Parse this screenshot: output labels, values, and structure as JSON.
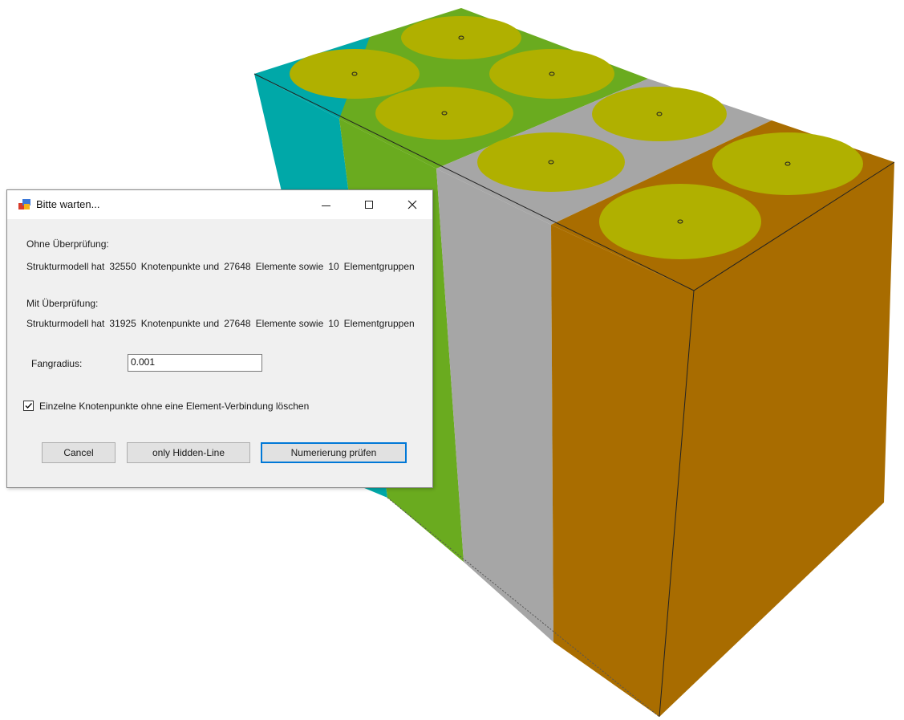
{
  "dialog": {
    "title": "Bitte warten...",
    "controls": {
      "minimize": "minimize",
      "maximize": "maximize",
      "close": "close"
    },
    "without_check": {
      "heading": "Ohne Überprüfung:",
      "prefix": "Strukturmodell hat",
      "nodes": "32550",
      "nodes_label": "Knotenpunkte und",
      "elements": "27648",
      "elements_label": "Elemente sowie",
      "groups": "10",
      "groups_label": "Elementgruppen"
    },
    "with_check": {
      "heading": "Mit Überprüfung:",
      "prefix": "Strukturmodell hat",
      "nodes": "31925",
      "nodes_label": "Knotenpunkte und",
      "elements": "27648",
      "elements_label": "Elemente sowie",
      "groups": "10",
      "groups_label": "Elementgruppen"
    },
    "capture_radius": {
      "label": "Fangradius:",
      "value": "0.001"
    },
    "delete_isolated": {
      "label": "Einzelne Knotenpunkte ohne eine Element-Verbindung löschen",
      "checked": true
    },
    "buttons": {
      "cancel": "Cancel",
      "hidden_line": "only Hidden-Line",
      "check_numbering": "Numerierung prüfen"
    }
  },
  "model": {
    "block_colors": [
      "#00a8a8",
      "#6aab1f",
      "#a6a6a6",
      "#a96d00"
    ],
    "circle_color": "#b0b000"
  }
}
